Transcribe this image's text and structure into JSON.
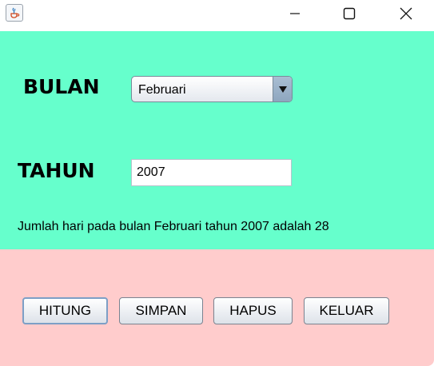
{
  "titlebar": {
    "app_icon": "java-icon",
    "controls": [
      "minimize-icon",
      "maximize-icon",
      "close-icon"
    ]
  },
  "form": {
    "bulan_label": "BULAN",
    "bulan_selected": "Februari",
    "tahun_label": "TAHUN",
    "tahun_value": "2007",
    "result_text": "Jumlah hari pada bulan Februari tahun 2007 adalah 28"
  },
  "buttons": {
    "hitung": "HITUNG",
    "simpan": "SIMPAN",
    "hapus": "HAPUS",
    "keluar": "KELUAR"
  },
  "colors": {
    "top_panel": "#66ffcc",
    "bottom_panel": "#ffcccc",
    "focus_border": "#7d9fc6"
  }
}
